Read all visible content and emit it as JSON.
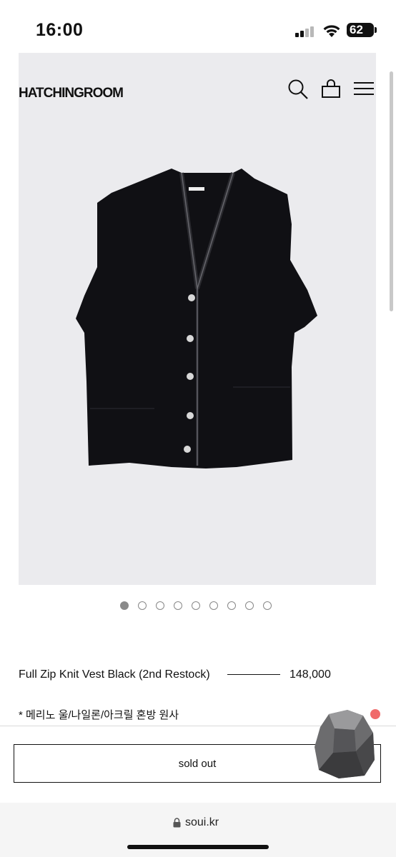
{
  "status_bar": {
    "time": "16:00",
    "battery": "62"
  },
  "header": {
    "logo": "HATCHINGROOM"
  },
  "product": {
    "title": "Full Zip Knit Vest Black (2nd Restock)",
    "price": "148,000",
    "note": "* 메리노 울/나일론/아크릴 혼방 원사",
    "image_count": 9,
    "active_image": 1
  },
  "actions": {
    "soldout_label": "sold out"
  },
  "browser": {
    "url": "soui.kr"
  },
  "colors": {
    "hero_bg": "#ebebee",
    "accent_dot": "#f06a6a"
  }
}
